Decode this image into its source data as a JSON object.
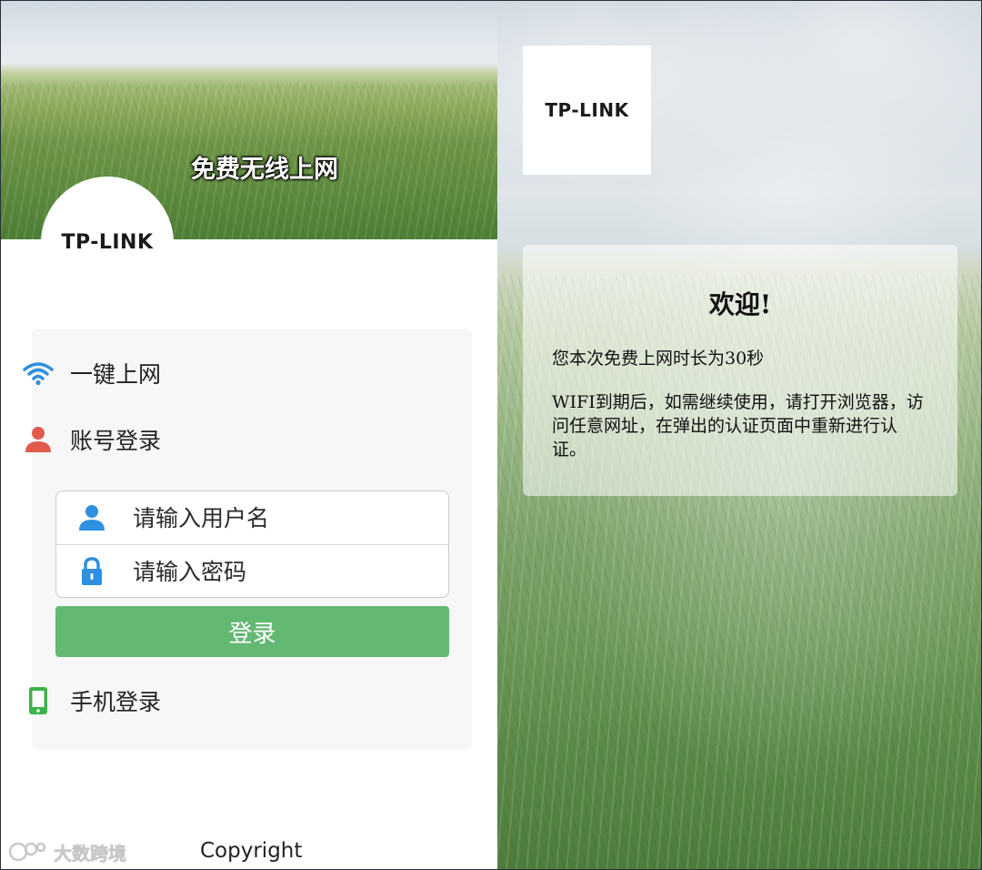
{
  "left_panel": {
    "banner_title": "免费无线上网",
    "logo_text": "TP-LINK",
    "menu": {
      "one_click_label": "一键上网",
      "account_login_label": "账号登录",
      "phone_login_label": "手机登录"
    },
    "form": {
      "username_placeholder": "请输入用户名",
      "password_placeholder": "请输入密码",
      "login_button": "登录"
    },
    "footer": {
      "copyright": "Copyright",
      "watermark": "大数跨境"
    }
  },
  "right_panel": {
    "logo_text": "TP-LINK",
    "welcome_title": "欢迎!",
    "duration_text": "您本次免费上网时长为30秒",
    "expiry_text": "WIFI到期后，如需继续使用，请打开浏览器，访问任意网址，在弹出的认证页面中重新进行认证。"
  },
  "colors": {
    "login_button": "#63b872",
    "wifi_icon": "#2f8fe0",
    "account_icon": "#e25a4e",
    "input_icon": "#2f8fe0",
    "phone_icon": "#3cb34a"
  },
  "icons": {
    "wifi": "wifi-icon",
    "account": "user-icon",
    "username": "user-icon",
    "password": "lock-icon",
    "phone": "phone-icon"
  }
}
